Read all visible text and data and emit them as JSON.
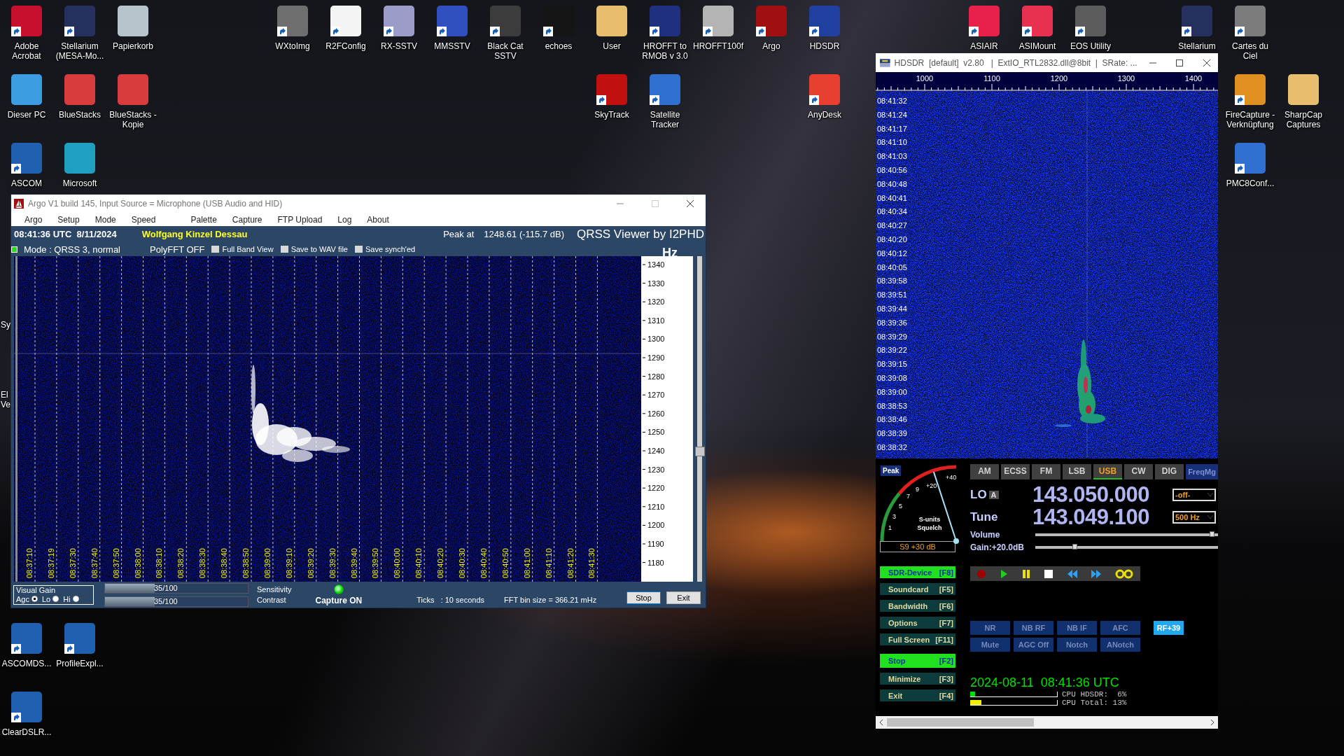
{
  "desktop_icons": [
    {
      "label": "Adobe Acrobat",
      "color": "#c8102e",
      "shortcut": true
    },
    {
      "label": "Stellarium (MESA-Mo...",
      "color": "#26305e",
      "shortcut": true
    },
    {
      "label": "Papierkorb",
      "color": "#b8c4cc",
      "shortcut": false
    },
    {
      "label": "WXtoImg",
      "color": "#6e6e6e",
      "shortcut": true
    },
    {
      "label": "R2FConfig",
      "color": "#f4f4f4",
      "shortcut": true
    },
    {
      "label": "RX-SSTV",
      "color": "#9c9cc8",
      "shortcut": true
    },
    {
      "label": "MMSSTV",
      "color": "#3050c0",
      "shortcut": true
    },
    {
      "label": "Black Cat SSTV",
      "color": "#3c3c3c",
      "shortcut": true
    },
    {
      "label": "echoes",
      "color": "#141414",
      "shortcut": true
    },
    {
      "label": "User",
      "color": "#e6be6e",
      "shortcut": false
    },
    {
      "label": "HROFFT to RMOB v 3.0",
      "color": "#203080",
      "shortcut": true
    },
    {
      "label": "HROFFT100f",
      "color": "#b4b4b4",
      "shortcut": true
    },
    {
      "label": "Argo",
      "color": "#a01010",
      "shortcut": true
    },
    {
      "label": "HDSDR",
      "color": "#2040a0",
      "shortcut": true
    },
    {
      "label": "ASIAIR",
      "color": "#e8204a",
      "shortcut": true
    },
    {
      "label": "ASIMount",
      "color": "#e83050",
      "shortcut": true
    },
    {
      "label": "EOS Utility",
      "color": "#5c5c5c",
      "shortcut": true
    },
    {
      "label": "Stellarium",
      "color": "#26305e",
      "shortcut": true
    },
    {
      "label": "Cartes du Ciel",
      "color": "#7c7c7c",
      "shortcut": true
    },
    {
      "label": "Dieser PC",
      "color": "#3c9ee0",
      "shortcut": false
    },
    {
      "label": "BlueStacks",
      "color": "#d83c3c",
      "shortcut": false
    },
    {
      "label": "BlueStacks - Kopie",
      "color": "#d83c3c",
      "shortcut": false
    },
    {
      "label": "SkyTrack",
      "color": "#c01010",
      "shortcut": true
    },
    {
      "label": "Satellite Tracker",
      "color": "#3070d0",
      "shortcut": true
    },
    {
      "label": "AnyDesk",
      "color": "#e84030",
      "shortcut": true
    },
    {
      "label": "FireCapture - Verknüpfung",
      "color": "#e09020",
      "shortcut": true
    },
    {
      "label": "SharpCap Captures",
      "color": "#e6be6e",
      "shortcut": false
    },
    {
      "label": "ASCOM",
      "color": "#2060b0",
      "shortcut": true
    },
    {
      "label": "Microsoft",
      "color": "#1fa0c0",
      "shortcut": false
    },
    {
      "label": "PMC8Conf...",
      "color": "#3070d0",
      "shortcut": true
    },
    {
      "label": "ASCOMDS...",
      "color": "#2060b0",
      "shortcut": true
    },
    {
      "label": "ProfileExpl...",
      "color": "#2060b0",
      "shortcut": true
    },
    {
      "label": "ClearDSLR...",
      "color": "#2060b0",
      "shortcut": true
    }
  ],
  "desktop_fragments": [
    "Sy",
    "El",
    "Ve"
  ],
  "argo": {
    "title": "Argo V1 build 145, Input Source = Microphone (USB Audio and HID)",
    "menu": [
      "Argo",
      "Setup",
      "Mode",
      "Speed",
      "Palette",
      "Capture",
      "FTP Upload",
      "Log",
      "About"
    ],
    "clock": "08:41:36 UTC  8/11/2024",
    "station": "Wolfgang Kinzel Dessau",
    "peak_label": "Peak at",
    "peak_value": "1248.61 (-115.7 dB)",
    "banner": "QRSS Viewer by I2PHD",
    "status_led_on": true,
    "mode": "Mode : QRSS 3, normal",
    "polyfft": "PolyFFT OFF",
    "options": [
      {
        "label": "Full Band View",
        "checked": false
      },
      {
        "label": "Save to WAV file",
        "checked": false
      },
      {
        "label": "Save synch'ed",
        "checked": false
      }
    ],
    "unit": "Hz",
    "freq_labels": [
      "1340",
      "1330",
      "1320",
      "1310",
      "1300",
      "1290",
      "1280",
      "1270",
      "1260",
      "1250",
      "1240",
      "1230",
      "1220",
      "1210",
      "1200",
      "1190",
      "1180"
    ],
    "time_labels": [
      "08:37:10",
      "08:37:19",
      "08:37:30",
      "08:37:40",
      "08:37:50",
      "08:38:00",
      "08:38:10",
      "08:38:20",
      "08:38:30",
      "08:38:40",
      "08:38:50",
      "08:39:00",
      "08:39:10",
      "08:39:20",
      "08:39:30",
      "08:39:40",
      "08:39:50",
      "08:40:00",
      "08:40:10",
      "08:40:20",
      "08:40:30",
      "08:40:40",
      "08:40:50",
      "08:41:00",
      "08:41:10",
      "08:41:20",
      "08:41:30"
    ],
    "visual_gain": {
      "title": "Visual Gain",
      "options": [
        {
          "label": "Agc",
          "selected": true
        },
        {
          "label": "Lo",
          "selected": false
        },
        {
          "label": "Hi",
          "selected": false
        }
      ]
    },
    "sliders": [
      {
        "value": "35/100",
        "level": 0.35,
        "label": "Sensitivity"
      },
      {
        "value": "35/100",
        "level": 0.35,
        "label": "Contrast"
      }
    ],
    "capture": {
      "on": true,
      "label": "Capture ON"
    },
    "ticks": "Ticks   : 10 seconds",
    "fft_bin": "FFT bin size = 366.21 mHz",
    "buttons": [
      "Stop",
      "Exit"
    ]
  },
  "hdsdr": {
    "title": "HDSDR  [default]  v2.80   |  ExtIO_RTL2832.dll@8bit  |  SRate: ...",
    "ruler_labels": [
      "1000",
      "1100",
      "1200",
      "1300",
      "1400"
    ],
    "time_labels": [
      "08:41:32",
      "08:41:24",
      "08:41:17",
      "08:41:10",
      "08:41:03",
      "08:40:56",
      "08:40:48",
      "08:40:41",
      "08:40:34",
      "08:40:27",
      "08:40:20",
      "08:40:12",
      "08:40:05",
      "08:39:58",
      "08:39:51",
      "08:39:44",
      "08:39:36",
      "08:39:29",
      "08:39:22",
      "08:39:15",
      "08:39:08",
      "08:39:00",
      "08:38:53",
      "08:38:46",
      "08:38:39",
      "08:38:32"
    ],
    "peak": "Peak",
    "meter": {
      "scale": [
        "1",
        "3",
        "5",
        "7",
        "9",
        "+20",
        "+40"
      ],
      "units": "S-units",
      "squelch": "Squelch",
      "level": 0.8,
      "reading": "S9 +30 dB"
    },
    "modes": [
      {
        "label": "AM",
        "selected": false
      },
      {
        "label": "ECSS",
        "selected": false
      },
      {
        "label": "FM",
        "selected": false
      },
      {
        "label": "LSB",
        "selected": false
      },
      {
        "label": "USB",
        "selected": true
      },
      {
        "label": "CW",
        "selected": false
      },
      {
        "label": "DIG",
        "selected": false
      }
    ],
    "freq_manager": "FreqMg",
    "lo": {
      "label": "LO",
      "badge": "A",
      "frequency": "143.050.000",
      "dropdown": "-off-"
    },
    "tune": {
      "label": "Tune",
      "frequency": "143.049.100",
      "dropdown": "500 Hz"
    },
    "volume": {
      "label": "Volume",
      "level": 0.97
    },
    "gain": {
      "label": "Gain:+20.0dB",
      "level": 0.22
    },
    "function_buttons": [
      {
        "label": "SDR-Device",
        "key": "[F8]",
        "active": true
      },
      {
        "label": "Soundcard",
        "key": "[F5]",
        "active": false
      },
      {
        "label": "Bandwidth",
        "key": "[F6]",
        "active": false
      },
      {
        "label": "Options",
        "key": "[F7]",
        "active": false
      },
      {
        "label": "Full Screen",
        "key": "[F11]",
        "active": false
      },
      {
        "label": "Stop",
        "key": "[F2]",
        "active": true
      },
      {
        "label": "Minimize",
        "key": "[F3]",
        "active": false
      },
      {
        "label": "Exit",
        "key": "[F4]",
        "active": false
      }
    ],
    "dsp_buttons": [
      {
        "label": "NR",
        "on": false
      },
      {
        "label": "NB RF",
        "on": false
      },
      {
        "label": "NB IF",
        "on": false
      },
      {
        "label": "AFC",
        "on": false
      },
      {
        "label": "RF+39",
        "on": true
      },
      {
        "label": "Mute",
        "on": false
      },
      {
        "label": "AGC Off",
        "on": false
      },
      {
        "label": "Notch",
        "on": false
      },
      {
        "label": "ANotch",
        "on": false
      }
    ],
    "datetime": "2024-08-11  08:41:36 UTC",
    "cpu": [
      {
        "label": "CPU HDSDR:  6%",
        "level": 0.06,
        "color": "#00e000"
      },
      {
        "label": "CPU Total: 13%",
        "level": 0.13,
        "color": "#f0f000"
      }
    ]
  }
}
